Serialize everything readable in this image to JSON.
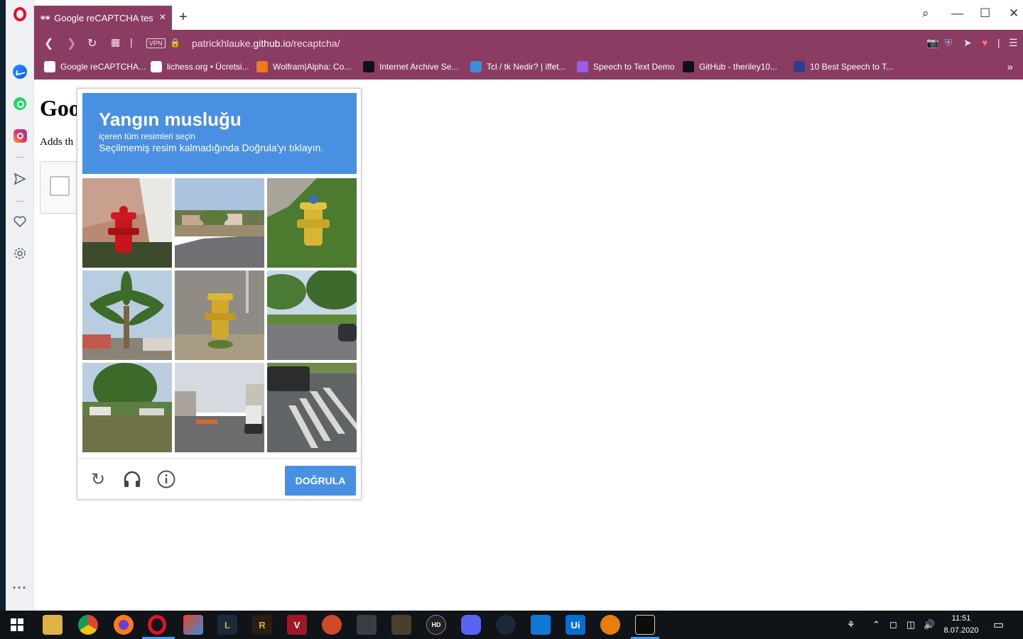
{
  "browser": {
    "tab": {
      "title": "Google reCAPTCHA test",
      "close_icon": "×"
    },
    "new_tab": "+",
    "window_controls": {
      "search": "⌕",
      "minimize": "—",
      "maximize": "☐",
      "close": "✕"
    },
    "address": {
      "vpn_label": "VPN",
      "url_prefix": "patrickhlauke.",
      "url_domain": "github.io",
      "url_path": "/recaptcha/"
    },
    "bookmarks": [
      {
        "label": "Google reCAPTCHA...",
        "color": "#ffffff"
      },
      {
        "label": "lichess.org • Ücretsi...",
        "color": "#ffffff"
      },
      {
        "label": "Wolfram|Alpha: Co...",
        "color": "#f07a1a"
      },
      {
        "label": "Internet Archive Se...",
        "color": "#111111"
      },
      {
        "label": "Tcl / tk Nedir? | iffet...",
        "color": "#3a8fd8"
      },
      {
        "label": "Speech to Text Demo",
        "color": "#9b5de5"
      },
      {
        "label": "GitHub - theriley10...",
        "color": "#111111"
      },
      {
        "label": "10 Best Speech to T...",
        "color": "#2c3e8c"
      }
    ],
    "bookmarks_more": "»"
  },
  "page": {
    "heading": "Goo",
    "text": "Adds th"
  },
  "captcha": {
    "title": "Yangın musluğu",
    "subtitle1": "içeren tüm resimleri seçin",
    "subtitle2": "Seçilmemiş resim kalmadığında Doğrula'yı tıklayın.",
    "verify_label": "DOĞRULA",
    "header_color": "#4a90e2"
  },
  "taskbar": {
    "time": "11:51",
    "date": "8.07.2020"
  }
}
